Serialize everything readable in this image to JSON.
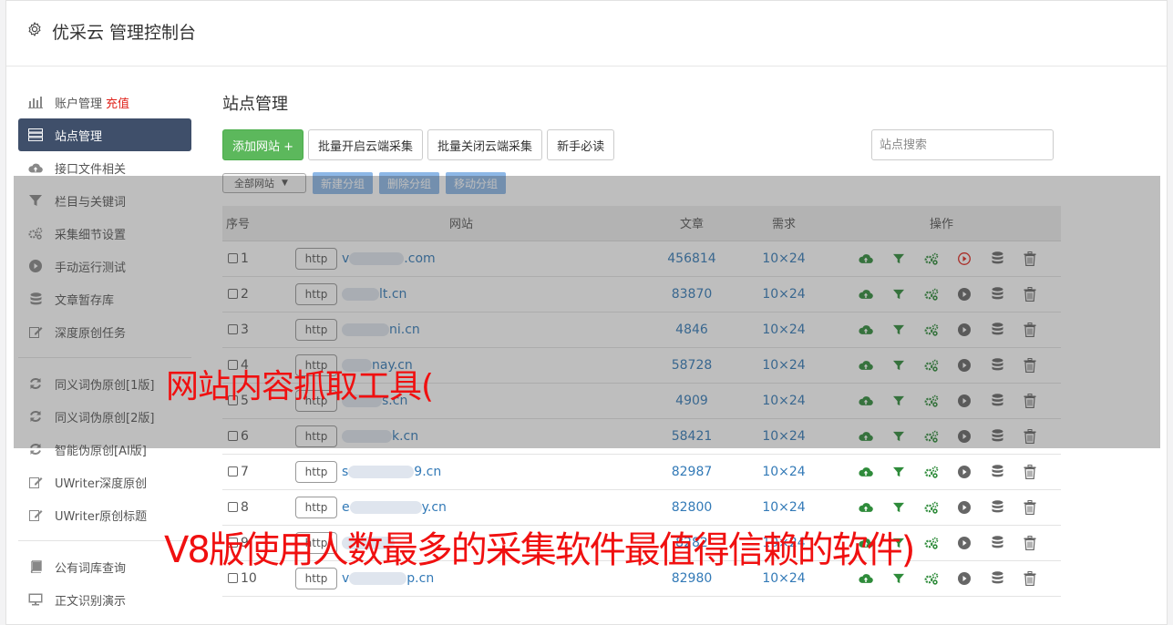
{
  "app": {
    "title": "优采云 管理控制台"
  },
  "sidebar": {
    "items": [
      {
        "label": "账户管理",
        "extra": "充值",
        "icon": "bar-chart-icon"
      },
      {
        "label": "站点管理",
        "icon": "server-icon",
        "active": true
      },
      {
        "label": "接口文件相关",
        "icon": "cloud-upload-icon"
      },
      {
        "label": "栏目与关键词",
        "icon": "filter-icon"
      },
      {
        "label": "采集细节设置",
        "icon": "cogs-icon"
      },
      {
        "label": "手动运行测试",
        "icon": "play-circle-icon"
      },
      {
        "label": "文章暂存库",
        "icon": "database-icon"
      },
      {
        "label": "深度原创任务",
        "icon": "edit-icon"
      }
    ],
    "items2": [
      {
        "label": "同义词伪原创[1版]",
        "icon": "refresh-icon"
      },
      {
        "label": "同义词伪原创[2版]",
        "icon": "refresh-icon"
      },
      {
        "label": "智能伪原创[AI版]",
        "icon": "refresh-icon"
      },
      {
        "label": "UWriter深度原创",
        "icon": "edit-icon"
      },
      {
        "label": "UWriter原创标题",
        "icon": "edit-icon"
      }
    ],
    "items3": [
      {
        "label": "公有词库查询",
        "icon": "book-icon"
      },
      {
        "label": "正文识别演示",
        "icon": "monitor-icon"
      }
    ]
  },
  "main": {
    "title": "站点管理",
    "toolbar": {
      "add_site": "添加网站 +",
      "batch_enable": "批量开启云端采集",
      "batch_disable": "批量关闭云端采集",
      "newbie": "新手必读"
    },
    "search": {
      "placeholder": "站点搜索"
    },
    "group_select": "全部网站",
    "group_buttons": {
      "new": "新建分组",
      "delete": "删除分组",
      "move": "移动分组"
    },
    "table": {
      "headers": {
        "index": "序号",
        "site": "网站",
        "articles": "文章",
        "demand": "需求",
        "ops": "操作"
      },
      "protocol": "http",
      "rows": [
        {
          "index": "1",
          "prefix": "v",
          "suffix": ".com",
          "articles": "456814",
          "demand": "10×24",
          "running": true
        },
        {
          "index": "2",
          "prefix": "",
          "suffix": "lt.cn",
          "articles": "83870",
          "demand": "10×24",
          "running": false
        },
        {
          "index": "3",
          "prefix": "",
          "suffix": "ni.cn",
          "articles": "4846",
          "demand": "10×24",
          "running": false
        },
        {
          "index": "4",
          "prefix": "",
          "suffix": "nay.cn",
          "articles": "58728",
          "demand": "10×24",
          "running": false
        },
        {
          "index": "5",
          "prefix": "",
          "suffix": "s.cn",
          "articles": "4909",
          "demand": "10×24",
          "running": false
        },
        {
          "index": "6",
          "prefix": "",
          "suffix": "k.cn",
          "articles": "58421",
          "demand": "10×24",
          "running": false
        },
        {
          "index": "7",
          "prefix": "s",
          "suffix": "9.cn",
          "articles": "82987",
          "demand": "10×24",
          "running": false
        },
        {
          "index": "8",
          "prefix": "e",
          "suffix": "y.cn",
          "articles": "82800",
          "demand": "10×24",
          "running": false
        },
        {
          "index": "9",
          "prefix": "",
          "suffix": "",
          "articles": "8282",
          "demand": "10×24",
          "running": false
        },
        {
          "index": "10",
          "prefix": "v",
          "suffix": "p.cn",
          "articles": "82980",
          "demand": "10×24",
          "running": false
        }
      ]
    }
  },
  "captions": {
    "line1": "网站内容抓取工具(",
    "line2": "V8版使用人数最多的采集软件最值得信赖的软件)"
  },
  "colors": {
    "green": "#5cb85c",
    "sidebar_active": "#3f4f6a",
    "link": "#337ab7",
    "caption": "#f01010",
    "play_active": "#e0221a"
  }
}
